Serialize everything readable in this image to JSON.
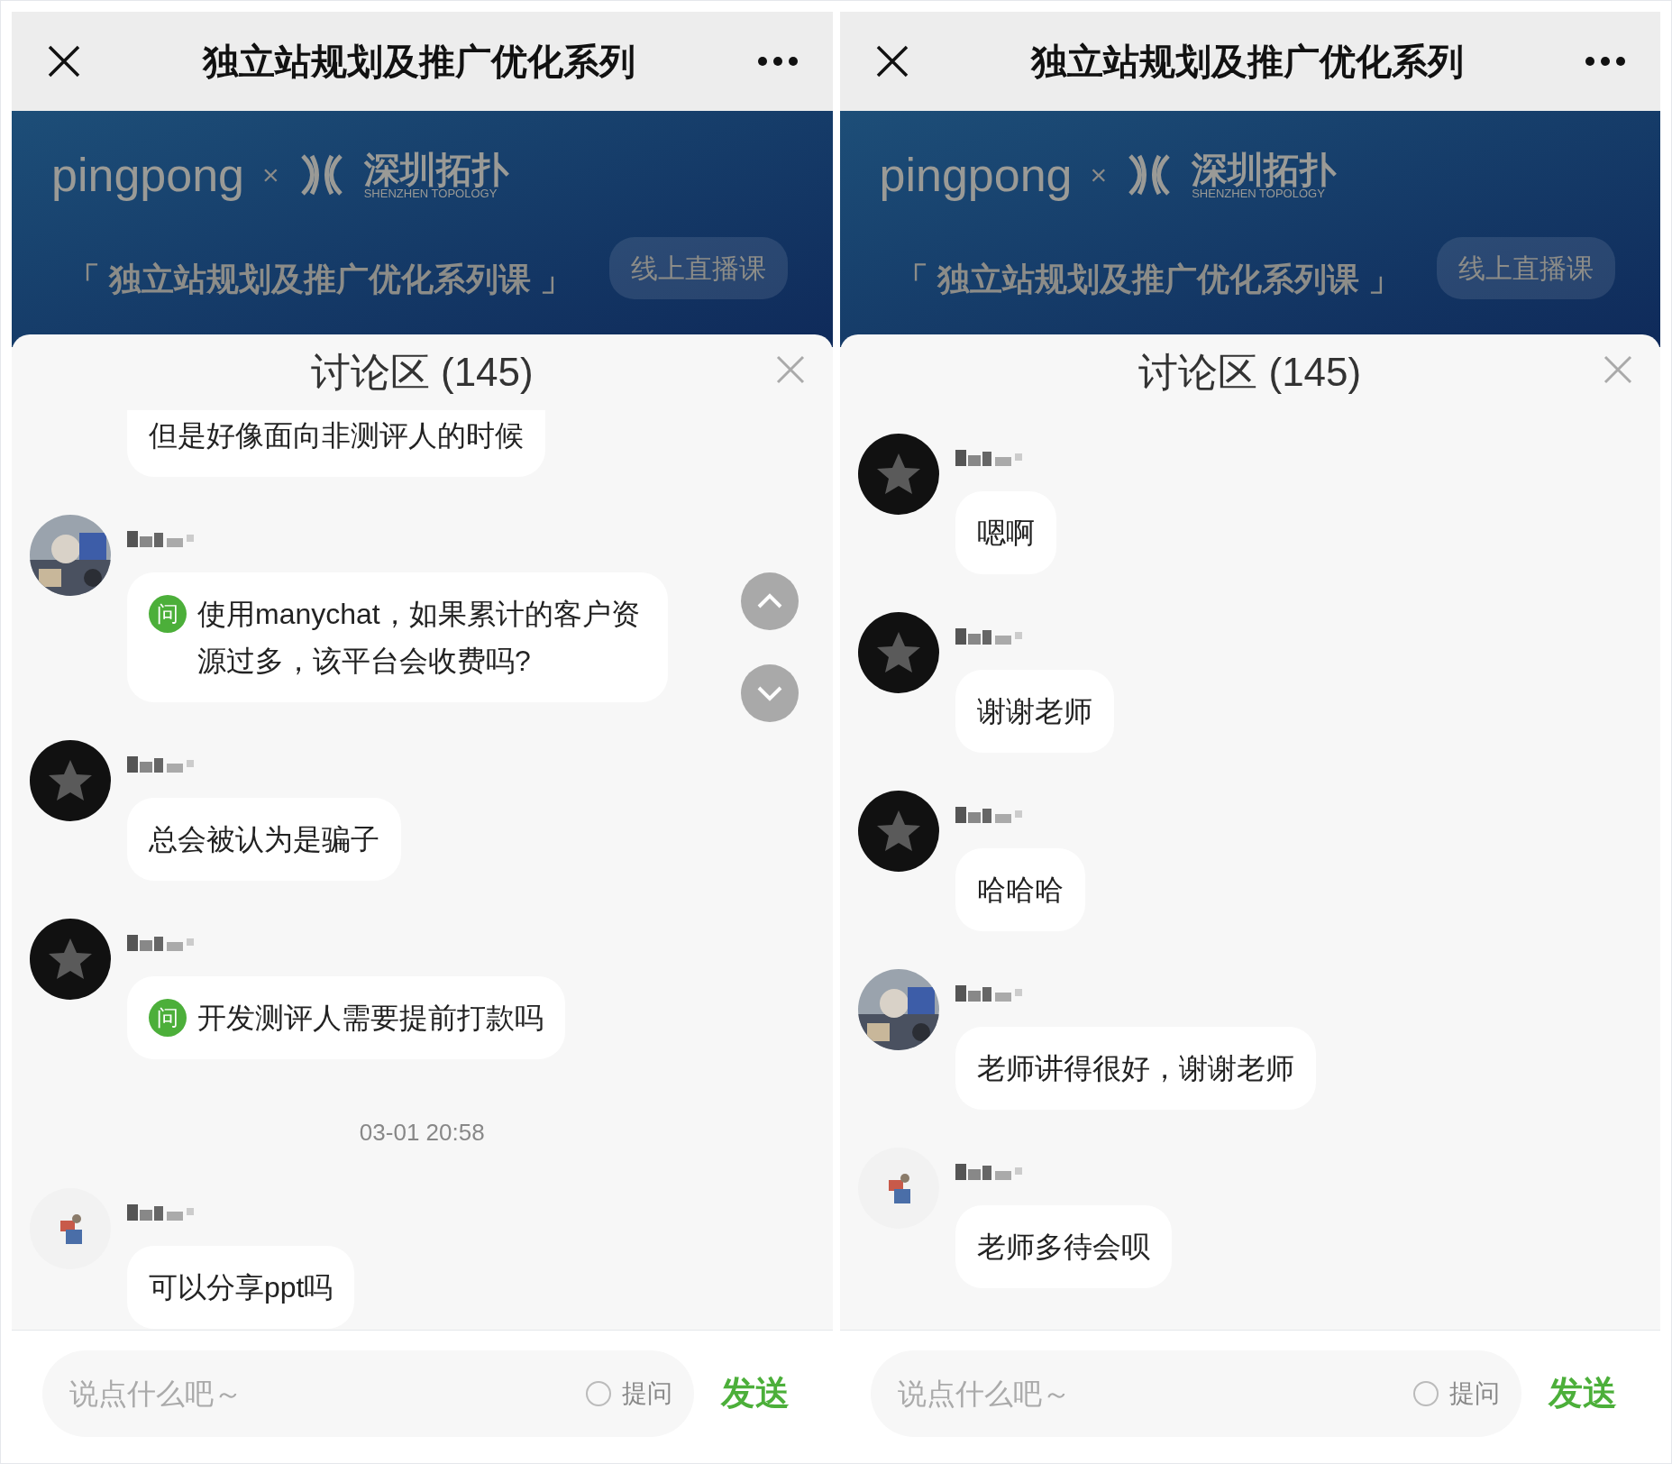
{
  "panels": [
    {
      "title": "独立站规划及推广优化系列",
      "banner": {
        "brand": "pingpong",
        "times": "×",
        "partner": "深圳拓扑",
        "partner_en": "SHENZHEN TOPOLOGY",
        "course": "「 独立站规划及推广优化系列课 」",
        "badge": "线上直播课"
      },
      "discussion": {
        "title": "讨论区 (145)"
      },
      "scroll_buttons": [
        {
          "kind": "up"
        },
        {
          "kind": "down"
        }
      ],
      "messages": [
        {
          "kind": "message",
          "cut_top": true,
          "text": "但是好像面向非测评人的时候"
        },
        {
          "kind": "message",
          "avatar": {
            "kind": "photo"
          },
          "badge": "问",
          "text": "使用manychat，如果累计的客户资源过多，该平台会收费吗?"
        },
        {
          "kind": "message",
          "avatar": {
            "kind": "dark"
          },
          "text": "总会被认为是骗子"
        },
        {
          "kind": "message",
          "avatar": {
            "kind": "dark"
          },
          "badge": "问",
          "text": "开发测评人需要提前打款吗"
        },
        {
          "kind": "timestamp",
          "text": "03-01 20:58"
        },
        {
          "kind": "message",
          "avatar": {
            "kind": "light"
          },
          "text": "可以分享ppt吗"
        }
      ],
      "composer": {
        "placeholder": "说点什么吧～",
        "ask_label": "提问",
        "ask_checked": false,
        "send": "发送"
      }
    },
    {
      "title": "独立站规划及推广优化系列",
      "banner": {
        "brand": "pingpong",
        "times": "×",
        "partner": "深圳拓扑",
        "partner_en": "SHENZHEN TOPOLOGY",
        "course": "「 独立站规划及推广优化系列课 」",
        "badge": "线上直播课"
      },
      "discussion": {
        "title": "讨论区 (145)"
      },
      "messages": [
        {
          "kind": "message",
          "avatar": {
            "kind": "dark"
          },
          "text": "嗯啊"
        },
        {
          "kind": "message",
          "avatar": {
            "kind": "dark"
          },
          "text": "谢谢老师"
        },
        {
          "kind": "message",
          "avatar": {
            "kind": "dark"
          },
          "text": "哈哈哈"
        },
        {
          "kind": "message",
          "avatar": {
            "kind": "photo"
          },
          "text": "老师讲得很好，谢谢老师"
        },
        {
          "kind": "message",
          "avatar": {
            "kind": "light"
          },
          "text": "老师多待会呗"
        }
      ],
      "composer": {
        "placeholder": "说点什么吧～",
        "ask_label": "提问",
        "ask_checked": false,
        "send": "发送"
      }
    }
  ]
}
